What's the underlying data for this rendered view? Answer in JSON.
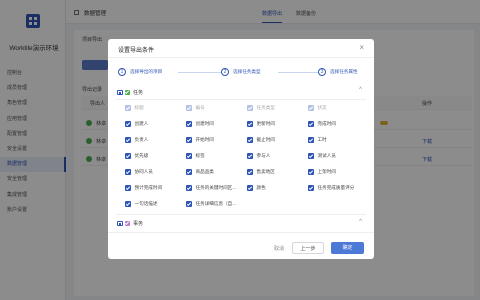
{
  "app": {
    "brand": "Worktile演示环境",
    "page_title": "数据管理"
  },
  "nav": [
    "控制台",
    "成员管理",
    "角色管理",
    "应用管理",
    "配置管理",
    "安全设置",
    "数据管理",
    "安全管理",
    "集成管理",
    "账户设置"
  ],
  "tabs": [
    "数据导出",
    "数据备份"
  ],
  "background": {
    "project_export_label": "项目导出",
    "export_records_label": "导出记录",
    "col_exporter": "导出人",
    "col_action": "操作",
    "download": "下载",
    "row_name": "林卓"
  },
  "modal": {
    "title": "设置导出条件",
    "close": "×",
    "steps": [
      {
        "num": "1",
        "label": "选择导出的项目"
      },
      {
        "num": "2",
        "label": "选择任务类型"
      },
      {
        "num": "3",
        "label": "选择任务属性"
      }
    ],
    "group_task": "任务",
    "group_affair": "事务",
    "chevron_up": "^",
    "fields": [
      "标题",
      "编号",
      "任务类型",
      "状态",
      "创建人",
      "创建时间",
      "更新时间",
      "完成时间",
      "负责人",
      "开始时间",
      "截止时间",
      "工时",
      "优先级",
      "标签",
      "参与人",
      "测试人员",
      "协同人员",
      "商品品类",
      "售卖地区",
      "上架时间",
      "预计完成时间",
      "任务的关键时间区...",
      "颜色",
      "任务完成质量评分",
      "一句话描述",
      "任务详细信息（自..."
    ],
    "buttons": {
      "cancel": "取消",
      "prev": "上一步",
      "ok": "确定"
    }
  }
}
